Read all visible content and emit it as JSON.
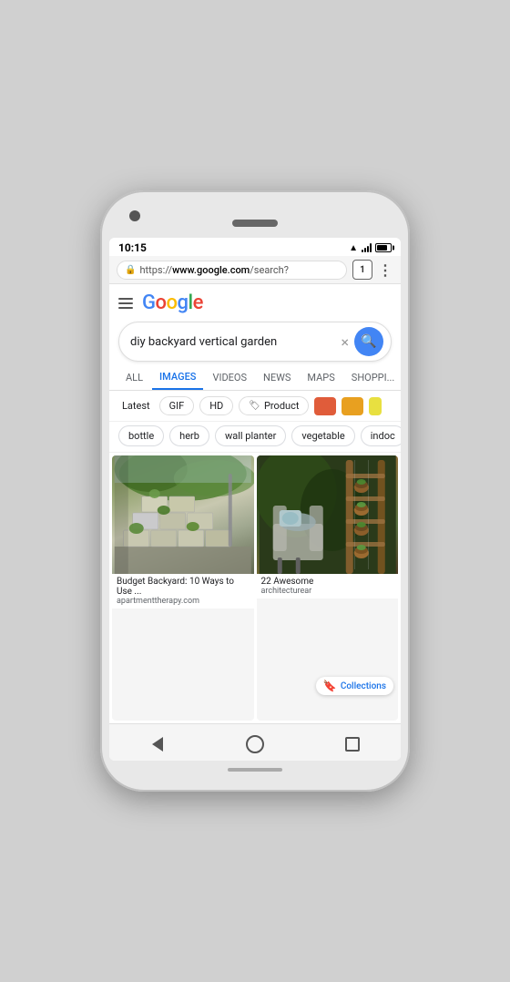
{
  "phone": {
    "time": "10:15",
    "url": {
      "protocol": "https://",
      "domain": "www.google.com",
      "path": "/search?"
    },
    "tab_count": "1"
  },
  "google": {
    "logo_letters": [
      {
        "letter": "G",
        "color_class": "g-blue"
      },
      {
        "letter": "o",
        "color_class": "g-red"
      },
      {
        "letter": "o",
        "color_class": "g-yellow"
      },
      {
        "letter": "g",
        "color_class": "g-blue"
      },
      {
        "letter": "l",
        "color_class": "g-green"
      },
      {
        "letter": "e",
        "color_class": "g-red"
      }
    ]
  },
  "search": {
    "query": "diy backyard vertical garden",
    "clear_btn": "×",
    "search_icon": "🔍"
  },
  "tabs": {
    "items": [
      {
        "label": "ALL",
        "active": false
      },
      {
        "label": "IMAGES",
        "active": true
      },
      {
        "label": "VIDEOS",
        "active": false
      },
      {
        "label": "NEWS",
        "active": false
      },
      {
        "label": "MAPS",
        "active": false
      },
      {
        "label": "SHOPPI...",
        "active": false
      }
    ]
  },
  "filters": {
    "latest_label": "Latest",
    "gif_label": "GIF",
    "hd_label": "HD",
    "product_label": "Product",
    "colors": [
      "#e05c3a",
      "#e8a020",
      "#e8e040"
    ],
    "tag_icon": "🏷"
  },
  "suggestions": {
    "chips": [
      "bottle",
      "herb",
      "wall planter",
      "vegetable",
      "indoc"
    ]
  },
  "images": [
    {
      "title": "Budget Backyard: 10 Ways to Use ...",
      "source": "apartmenttherapy.com",
      "type": "cinder"
    },
    {
      "title": "22 Awesome",
      "source": "architecturear",
      "type": "wooden",
      "badge": "Collections"
    }
  ],
  "nav": {
    "back_label": "back",
    "home_label": "home",
    "recent_label": "recent"
  }
}
